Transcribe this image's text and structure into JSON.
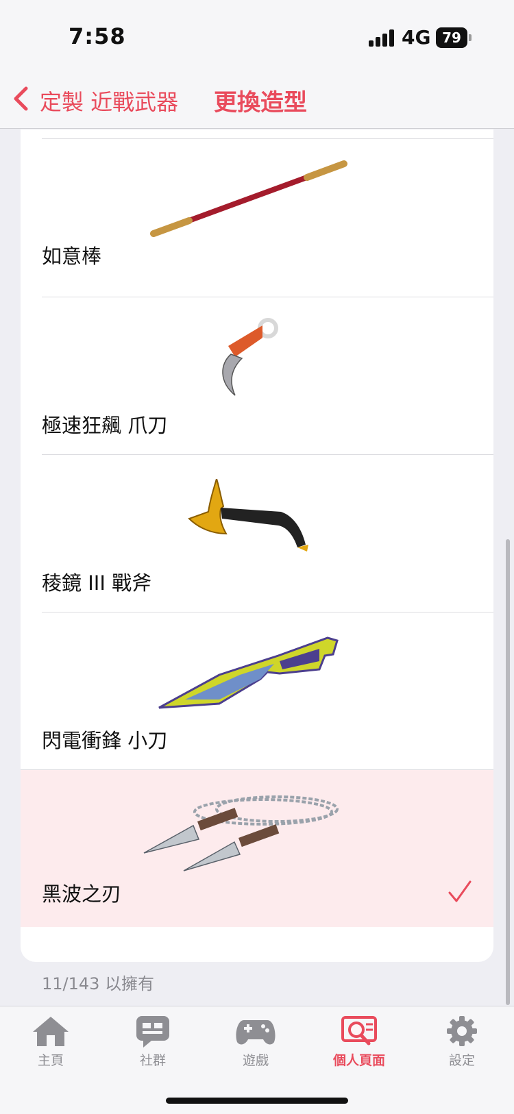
{
  "status_bar": {
    "time": "7:58",
    "network": "4G",
    "battery": "79"
  },
  "nav": {
    "back_label": "定製 近戰武器",
    "title": "更換造型",
    "accent_color": "#e94b5c"
  },
  "items": [
    {
      "name": "如意棒",
      "icon": "staff-icon",
      "selected": false
    },
    {
      "name": "極速狂飆 爪刀",
      "icon": "karambit-icon",
      "selected": false
    },
    {
      "name": "稜鏡 III 戰斧",
      "icon": "axe-icon",
      "selected": false
    },
    {
      "name": "閃電衝鋒 小刀",
      "icon": "knife-icon",
      "selected": false
    },
    {
      "name": "黑波之刃",
      "icon": "kunai-chain-icon",
      "selected": true
    }
  ],
  "owned_count": "11/143 以擁有",
  "tabs": [
    {
      "label": "主頁",
      "icon": "home-icon",
      "active": false
    },
    {
      "label": "社群",
      "icon": "chat-icon",
      "active": false
    },
    {
      "label": "遊戲",
      "icon": "gamepad-icon",
      "active": false
    },
    {
      "label": "個人頁面",
      "icon": "profile-search-icon",
      "active": true
    },
    {
      "label": "設定",
      "icon": "gear-icon",
      "active": false
    }
  ]
}
